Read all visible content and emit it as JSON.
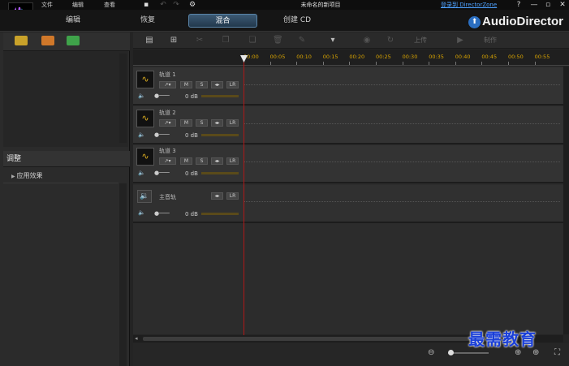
{
  "menu": {
    "file": "文件",
    "edit": "编辑",
    "view": "查看"
  },
  "window": {
    "title": "未命名的新项目",
    "login": "登录到 DirectorZone",
    "help": "?"
  },
  "modes": {
    "edit": "编辑",
    "restore": "恢复",
    "mix": "混合",
    "cd": "创建 CD"
  },
  "brand": "AudioDirector",
  "toolbar": {
    "upload": "上传",
    "produce": "制作"
  },
  "left_panel": {
    "adjust_title": "调整",
    "apply_effects": "应用效果"
  },
  "ruler": [
    "00:00",
    "00:05",
    "00:10",
    "00:15",
    "00:20",
    "00:25",
    "00:30",
    "00:35",
    "00:40",
    "00:45",
    "00:50",
    "00:55"
  ],
  "tracks": [
    {
      "name": "轨道 1",
      "volume": "0 dB"
    },
    {
      "name": "轨道 2",
      "volume": "0 dB"
    },
    {
      "name": "轨道 3",
      "volume": "0 dB"
    }
  ],
  "master": {
    "name": "主音轨",
    "volume": "0 dB"
  },
  "track_buttons": {
    "mute": "M",
    "solo": "S"
  },
  "watermark": "最需教育"
}
